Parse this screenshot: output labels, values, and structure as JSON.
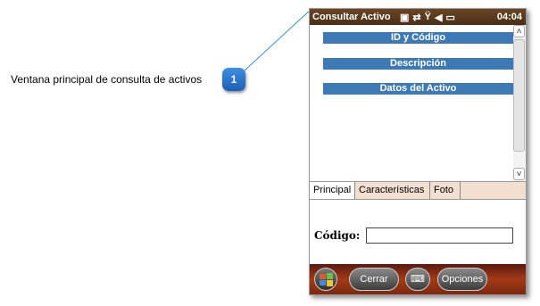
{
  "annotation": {
    "text": "Ventana principal de consulta de activos",
    "badge": "1"
  },
  "titlebar": {
    "title": "Consultar Activo",
    "time": "04:04",
    "icons": [
      "notification-icon",
      "sync-icon",
      "signal-off-icon",
      "speaker-mute-icon",
      "battery-icon"
    ]
  },
  "sections": [
    "ID y Código",
    "Descripción",
    "Datos del Activo"
  ],
  "tabs": [
    "Principal",
    "Características",
    "Foto"
  ],
  "form": {
    "code_label": "Código:",
    "code_value": ""
  },
  "menubar": {
    "close_label": "Cerrar",
    "options_label": "Opciones"
  },
  "colors": {
    "titlebar": "#5b3a1e",
    "section_header": "#3d7ab5",
    "tabstrip": "#f2dfd0",
    "menubar": "#a33a16",
    "badge": "#2a75d0"
  }
}
